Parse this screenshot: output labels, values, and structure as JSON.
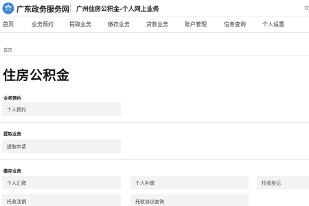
{
  "header": {
    "brand": "广东政务服务网",
    "site_title": "广州住房公积金-个人网上业务",
    "corner_text": "欢"
  },
  "nav": {
    "items": [
      "首页",
      "业务预约",
      "提取业务",
      "缴存业务",
      "贷款业务",
      "账户管理",
      "信息查询",
      "个人设置"
    ]
  },
  "breadcrumb": "首页",
  "page_title": "住房公积金",
  "sections": [
    {
      "title": "业务预约",
      "cards": [
        "个人预约"
      ]
    },
    {
      "title": "提取业务",
      "cards": [
        "提取申请"
      ]
    },
    {
      "title": "缴存业务",
      "cards": [
        "个人汇缴",
        "个人补缴",
        "托收登记",
        "托收注销",
        "托收协议查询"
      ]
    }
  ],
  "colors": {
    "logo_blue": "#3a87d9",
    "card_bg": "#f3f3f3"
  }
}
